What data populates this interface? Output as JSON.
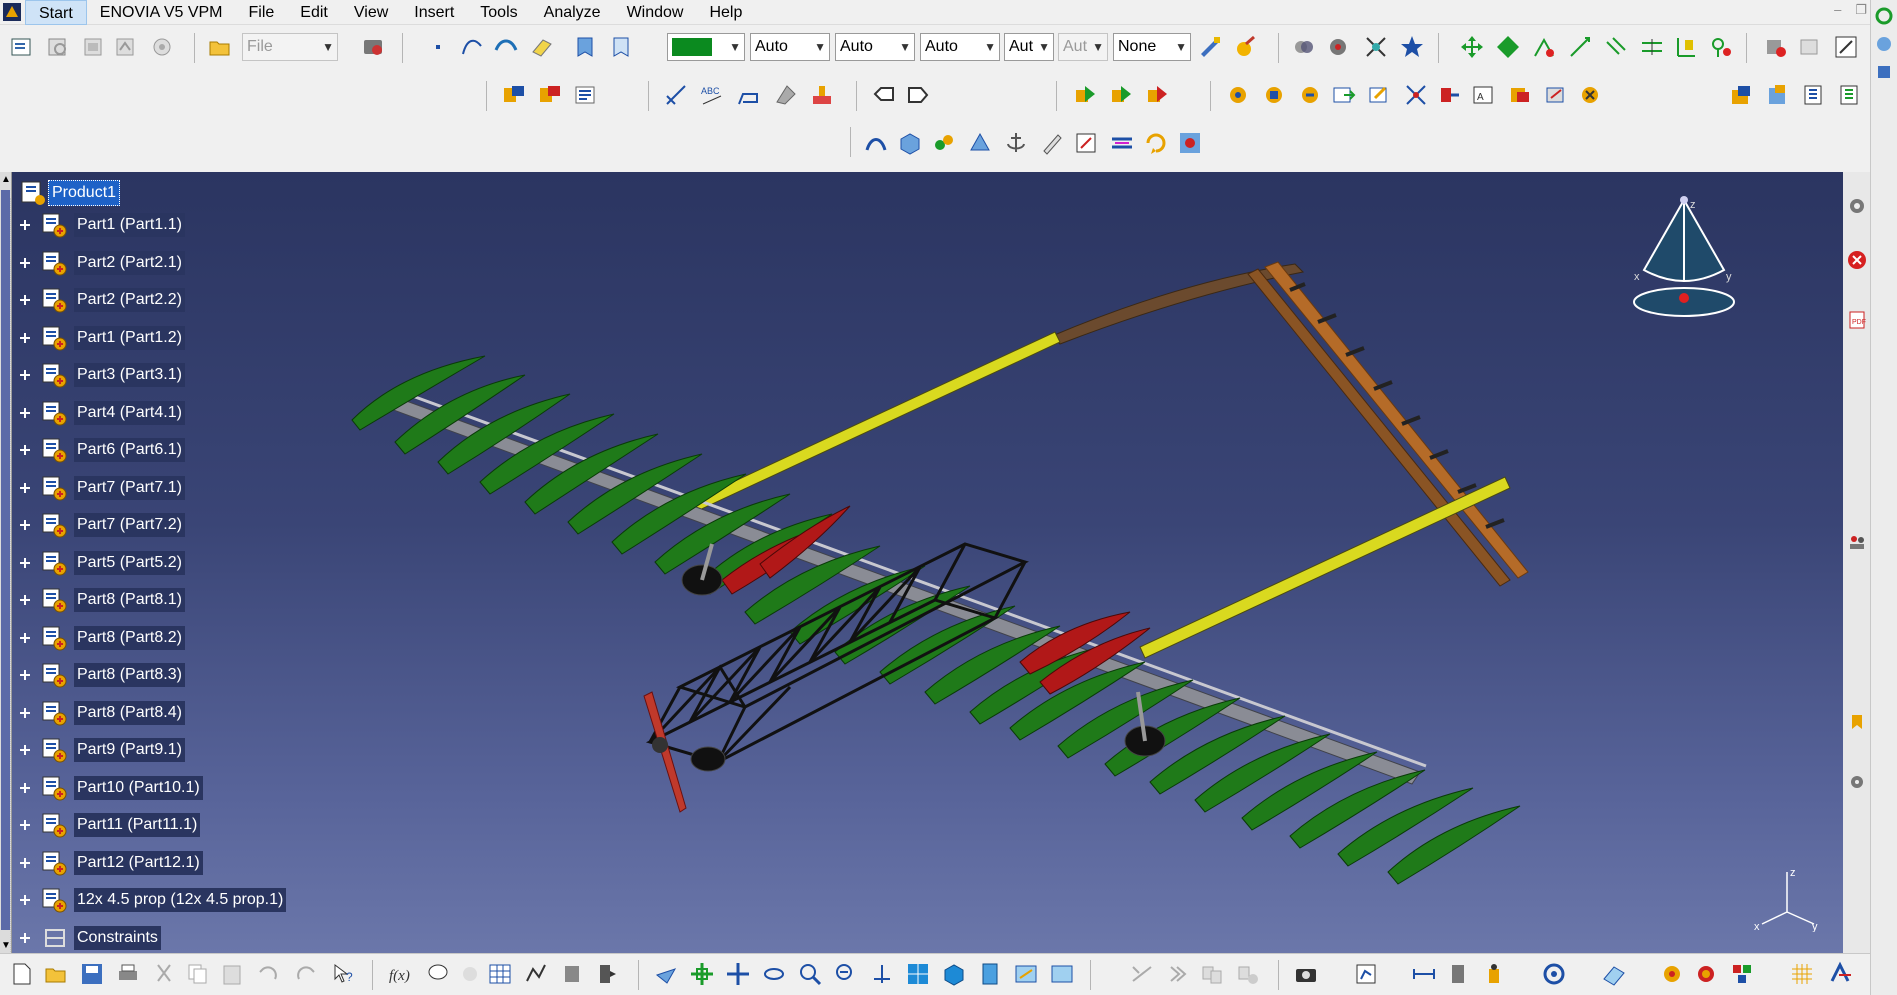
{
  "menubar": {
    "items": [
      "Start",
      "ENOVIA V5 VPM",
      "File",
      "Edit",
      "View",
      "Insert",
      "Tools",
      "Analyze",
      "Window",
      "Help"
    ],
    "active": "Start"
  },
  "toolbar": {
    "file_combo": "File",
    "color_combo": "",
    "line_type_combo": "Auto",
    "line_thickness_combo": "Auto",
    "point_type_combo": "Auto",
    "layer_combo": "Aut",
    "transparency_combo": "Aut",
    "rendering_combo": "None",
    "accent_color": "#0b8a1f"
  },
  "tree": {
    "root": "Product1",
    "nodes": [
      "Part1 (Part1.1)",
      "Part2 (Part2.1)",
      "Part2 (Part2.2)",
      "Part1 (Part1.2)",
      "Part3 (Part3.1)",
      "Part4 (Part4.1)",
      "Part6 (Part6.1)",
      "Part7 (Part7.1)",
      "Part7 (Part7.2)",
      "Part5 (Part5.2)",
      "Part8 (Part8.1)",
      "Part8 (Part8.2)",
      "Part8 (Part8.3)",
      "Part8 (Part8.4)",
      "Part9 (Part9.1)",
      "Part10 (Part10.1)",
      "Part11 (Part11.1)",
      "Part12 (Part12.1)",
      "12x 4.5 prop (12x 4.5 prop.1)",
      "Constraints"
    ]
  },
  "compass": {
    "axis_z": "z",
    "axis_x": "x",
    "axis_y": "y"
  },
  "triad": {
    "axis_z": "z",
    "axis_x": "x",
    "axis_y": "y"
  },
  "colors": {
    "viewport_top": "#2b3561",
    "viewport_bottom": "#6b77aa",
    "wing_green": "#1f7a19",
    "wing_red": "#b11818",
    "spar_yellow": "#d9d91f",
    "tail_brown": "#6b4a2e",
    "selection_blue": "#1e62c7"
  }
}
